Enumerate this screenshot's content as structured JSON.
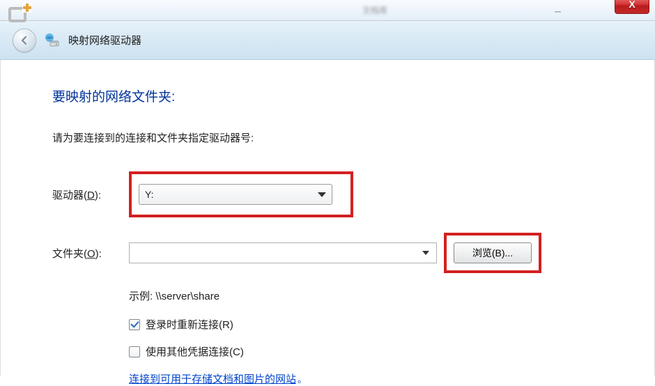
{
  "titlebar": {
    "blur_text": "文档库",
    "close_label": "X"
  },
  "nav": {
    "title": "映射网络驱动器"
  },
  "content": {
    "heading": "要映射的网络文件夹:",
    "subheading": "请为要连接到的连接和文件夹指定驱动器号:",
    "drive_label_pre": "驱动器(",
    "drive_label_key": "D",
    "drive_label_post": "):",
    "drive_value": "Y:",
    "folder_label_pre": "文件夹(",
    "folder_label_key": "O",
    "folder_label_post": "):",
    "folder_value": "",
    "browse_label": "浏览(B)...",
    "example_text": "示例: \\\\server\\share",
    "reconnect_label": "登录时重新连接(R)",
    "reconnect_checked": true,
    "othercred_label": "使用其他凭据连接(C)",
    "othercred_checked": false,
    "link_text": "连接到可用于存储文档和图片的网站",
    "link_period": "。"
  }
}
